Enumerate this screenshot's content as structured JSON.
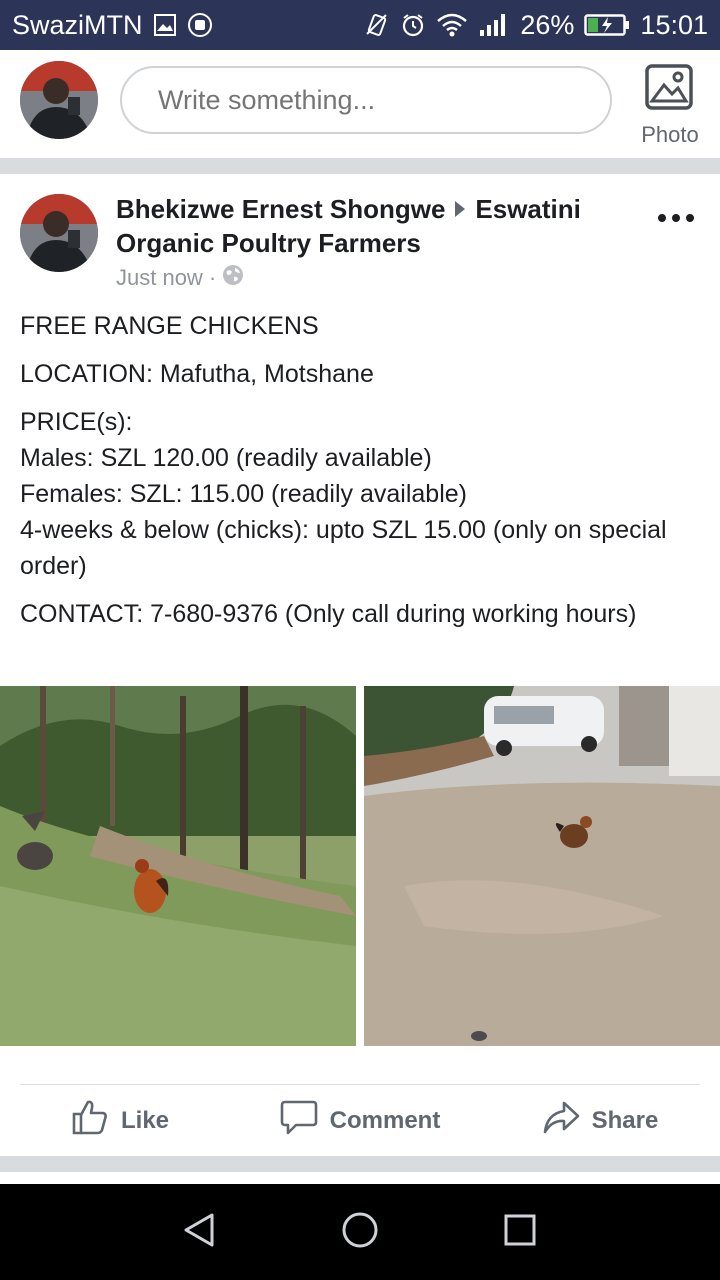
{
  "status_bar": {
    "carrier": "SwaziMTN",
    "battery": "26%",
    "time": "15:01"
  },
  "composer": {
    "placeholder": "Write something...",
    "photo_label": "Photo"
  },
  "post": {
    "author": "Bhekizwe Ernest Shongwe",
    "group": "Eswatini Organic Poultry Farmers",
    "timestamp": "Just now",
    "meta_separator": "·",
    "body": {
      "line1": "FREE RANGE CHICKENS",
      "line2": "LOCATION: Mafutha, Motshane",
      "price_header": "PRICE(s):",
      "price_males": "Males: SZL 120.00 (readily available)",
      "price_females": "Females: SZL: 115.00 (readily available)",
      "price_chicks": "4-weeks & below (chicks): upto SZL 15.00 (only on special order)",
      "contact": "CONTACT: 7-680-9376 (Only call during working hours)"
    },
    "actions": {
      "like": "Like",
      "comment": "Comment",
      "share": "Share"
    }
  },
  "colors": {
    "status_bar_bg": "#2c3458",
    "text_primary": "#1c1e21",
    "text_secondary": "#606770",
    "divider": "#d9dcdf"
  }
}
